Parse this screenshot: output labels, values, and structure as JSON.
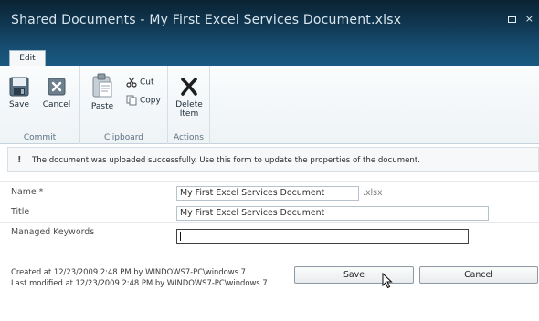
{
  "window": {
    "title": "Shared Documents - My First Excel Services Document.xlsx",
    "maximize_icon": "maximize-icon",
    "close_label": "×"
  },
  "ribbon": {
    "tabs": [
      {
        "label": "Edit",
        "active": true
      }
    ],
    "groups": {
      "commit": {
        "label": "Commit",
        "save_label": "Save",
        "cancel_label": "Cancel"
      },
      "clipboard": {
        "label": "Clipboard",
        "paste_label": "Paste",
        "cut_label": "Cut",
        "copy_label": "Copy"
      },
      "actions": {
        "label": "Actions",
        "delete_label_line1": "Delete",
        "delete_label_line2": "Item"
      }
    }
  },
  "message": {
    "icon": "!",
    "text": "The document was uploaded successfully. Use this form to update the properties of the document."
  },
  "form": {
    "name": {
      "label": "Name *",
      "value": "My First Excel Services Document",
      "extension": ".xlsx"
    },
    "title": {
      "label": "Title",
      "value": "My First Excel Services Document"
    },
    "keywords": {
      "label": "Managed Keywords",
      "value": ""
    }
  },
  "footer": {
    "created": "Created at 12/23/2009 2:48 PM by WINDOWS7-PC\\windows 7",
    "modified": "Last modified at 12/23/2009 2:48 PM by WINDOWS7-PC\\windows 7",
    "save_label": "Save",
    "cancel_label": "Cancel"
  },
  "colors": {
    "titlebar": "#113a55",
    "ribbon_bg": "#eef3f6",
    "accent": "#164c6f"
  }
}
